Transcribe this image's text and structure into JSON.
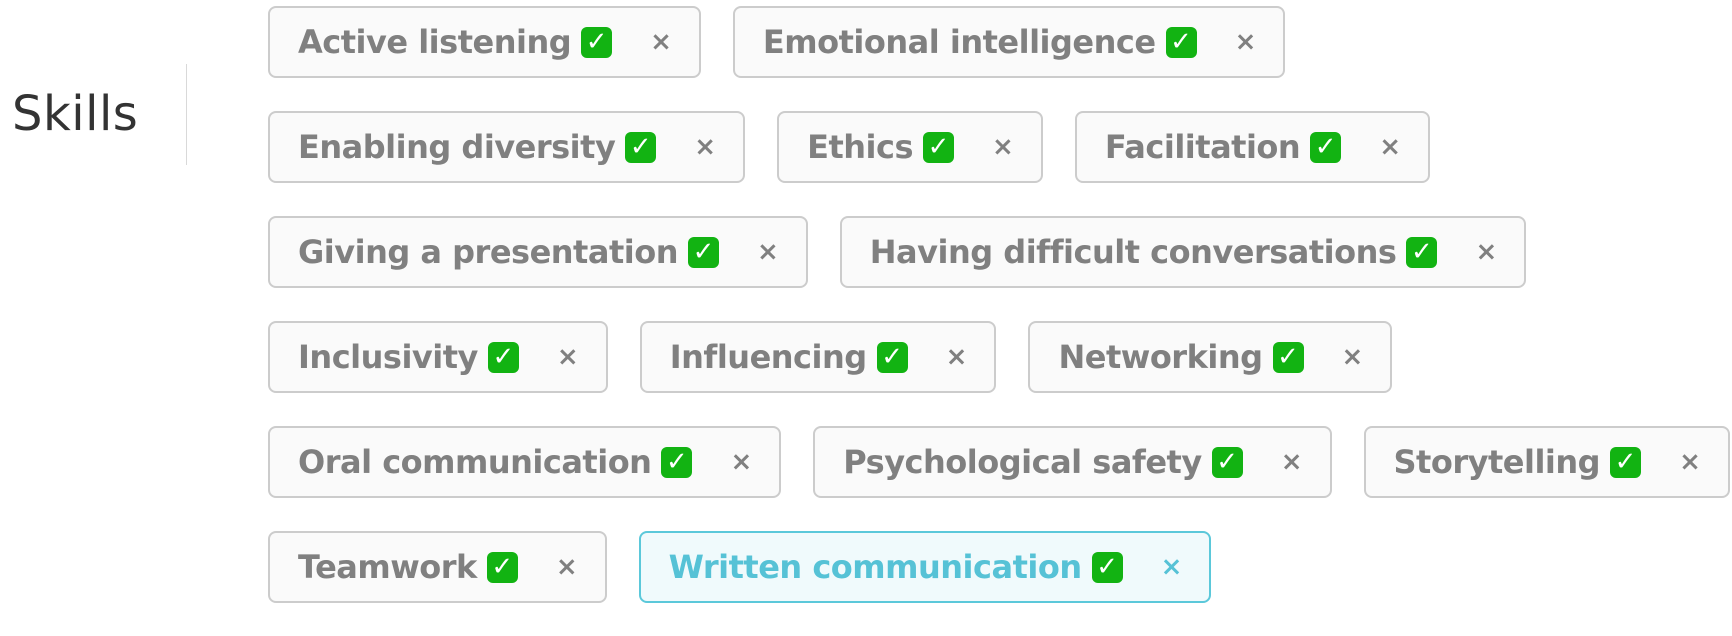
{
  "field": {
    "label": "Skills"
  },
  "accent_color": "#56c2d6",
  "rows": [
    [
      {
        "label": "Active listening",
        "active": false
      },
      {
        "label": "Emotional intelligence",
        "active": false
      }
    ],
    [
      {
        "label": "Enabling diversity",
        "active": false
      },
      {
        "label": "Ethics",
        "active": false
      },
      {
        "label": "Facilitation",
        "active": false
      }
    ],
    [
      {
        "label": "Giving a presentation",
        "active": false
      },
      {
        "label": "Having difficult conversations",
        "active": false
      }
    ],
    [
      {
        "label": "Inclusivity",
        "active": false
      },
      {
        "label": "Influencing",
        "active": false
      },
      {
        "label": "Networking",
        "active": false
      }
    ],
    [
      {
        "label": "Oral communication",
        "active": false
      },
      {
        "label": "Psychological safety",
        "active": false
      },
      {
        "label": "Storytelling",
        "active": false
      }
    ],
    [
      {
        "label": "Teamwork",
        "active": false
      },
      {
        "label": "Written communication",
        "active": true
      }
    ]
  ],
  "icons": {
    "check": "✓",
    "remove": "×"
  }
}
